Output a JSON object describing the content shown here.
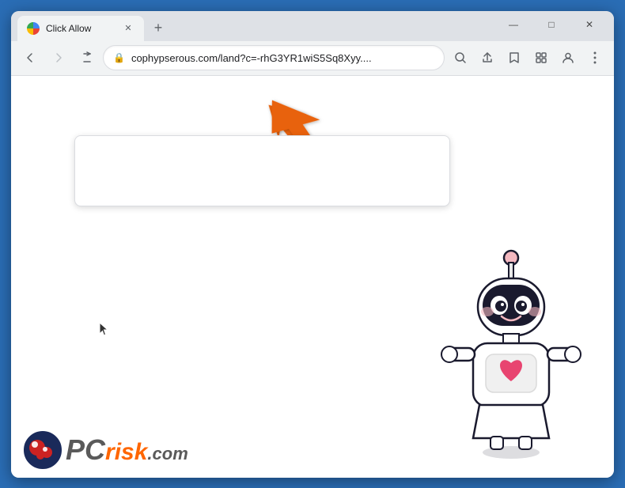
{
  "window": {
    "title": "Click Allow",
    "url": "cophypserous.com/land?c=-rhG3YR1wiS5Sq8Xyy....",
    "url_display": "cophypserous.com/land?c=-rhG3YR1wiS5Sq8Xyy....",
    "favicon_alt": "browser favicon"
  },
  "tabs": [
    {
      "title": "Click Allow",
      "active": true
    }
  ],
  "toolbar": {
    "back_label": "←",
    "forward_label": "→",
    "reload_label": "✕",
    "new_tab_label": "+",
    "search_icon_label": "🔍",
    "share_icon_label": "⬆",
    "bookmark_icon_label": "☆",
    "extensions_icon_label": "▣",
    "profile_icon_label": "👤",
    "menu_icon_label": "⋮"
  },
  "window_controls": {
    "minimize": "—",
    "maximize": "□",
    "close": "✕"
  },
  "pcrisk": {
    "pc_text": "PC",
    "risk_text": "risk",
    "dotcom_text": ".com"
  },
  "arrow": {
    "color": "#e8620a"
  }
}
